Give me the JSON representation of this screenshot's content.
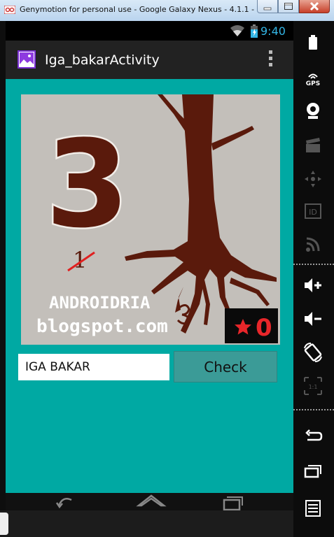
{
  "window": {
    "title": "Genymotion for personal use - Google Galaxy Nexus - 4.1.1 - ...",
    "controls": [
      "minimize",
      "maximize",
      "close"
    ]
  },
  "statusbar": {
    "time": "9:40",
    "icons": [
      "wifi-icon",
      "battery-icon"
    ]
  },
  "actionbar": {
    "title": "Iga_bakarActivity",
    "icons": [
      "app-icon",
      "overflow-menu-icon"
    ]
  },
  "image": {
    "number": "3",
    "crossed": "1",
    "line1": "ANDROIDRIA",
    "line2": "blogspot.com",
    "score": "0",
    "score_icon": "star-icon",
    "colors": {
      "tree": "#5a1a0c",
      "background": "#c3bfba",
      "score_star": "#e8262a"
    }
  },
  "form": {
    "input_value": "IGA BAKAR",
    "button_label": "Check"
  },
  "navbar": {
    "icons": [
      "back-icon",
      "home-icon",
      "recent-apps-icon"
    ]
  },
  "sidebar": {
    "items": [
      "battery-icon",
      "gps-icon",
      "webcam-icon",
      "video-icon",
      "dpad-icon",
      "id-icon",
      "rss-icon",
      "volume-up-icon",
      "volume-down-icon",
      "rotate-icon",
      "pixel-perfect-icon",
      "back-icon",
      "recent-apps-icon",
      "menu-icon"
    ],
    "gps_label": "GPS"
  },
  "colors": {
    "content_bg": "#00a9a3",
    "actionbar_bg": "#222222",
    "clock": "#33b5e5",
    "button_bg": "#3b9b97"
  }
}
